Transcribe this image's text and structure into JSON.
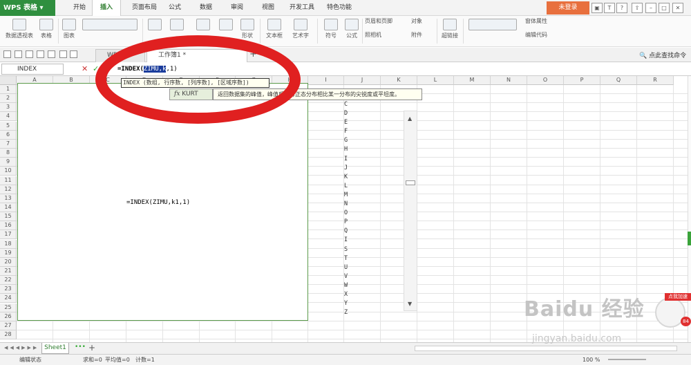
{
  "app": {
    "name": "WPS 表格",
    "login": "未登录"
  },
  "menu": [
    "开始",
    "插入",
    "页面布局",
    "公式",
    "数据",
    "审阅",
    "视图",
    "开发工具",
    "特色功能"
  ],
  "menu_active": 1,
  "ribbon": [
    {
      "label": "数据透视表"
    },
    {
      "label": "表格"
    },
    {
      "label": "图表"
    },
    {
      "label": ""
    },
    {
      "label": ""
    },
    {
      "label": ""
    },
    {
      "label": ""
    },
    {
      "label": ""
    },
    {
      "label": "形状"
    },
    {
      "label": "文本框"
    },
    {
      "label": "艺术字"
    },
    {
      "label": "符号"
    },
    {
      "label": "公式"
    },
    {
      "label": "页眉和页脚"
    },
    {
      "label": "对象"
    },
    {
      "label": "照相机"
    },
    {
      "label": "附件"
    },
    {
      "label": "超链接"
    },
    {
      "label": ""
    },
    {
      "label": "窗体属性"
    },
    {
      "label": "编辑代码"
    }
  ],
  "tabs": [
    {
      "label": "WPS"
    },
    {
      "label": "工作簿1 *"
    }
  ],
  "search": "点此查找命令",
  "namebox": "INDEX",
  "formula": {
    "pre": "=INDEX(",
    "mid": "ZIMU,k",
    "post": ",1)"
  },
  "columns": [
    "A",
    "B",
    "C",
    "D",
    "E",
    "F",
    "G",
    "H",
    "I",
    "J",
    "K",
    "L",
    "M",
    "N",
    "O",
    "P",
    "Q",
    "R"
  ],
  "rows": [
    "1",
    "2",
    "3",
    "4",
    "5",
    "6",
    "7",
    "8",
    "9",
    "10",
    "11",
    "12",
    "13",
    "14",
    "15",
    "16",
    "17",
    "18",
    "19",
    "20",
    "21",
    "22",
    "23",
    "24",
    "25",
    "26",
    "27",
    "28"
  ],
  "list": [
    "C",
    "D",
    "E",
    "F",
    "G",
    "H",
    "I",
    "J",
    "K",
    "L",
    "M",
    "N",
    "O",
    "P",
    "Q",
    "I",
    "S",
    "T",
    "U",
    "V",
    "W",
    "X",
    "Y",
    "Z"
  ],
  "cell_formula": "=INDEX(ZIMU,k1,1)",
  "tooltip": "INDEX (数组, 行序数, [列序数], [区域序数])",
  "suggestion": "KURT",
  "description": "返回数据集的峰值，峰值反映与正态分布相比某一分布的尖锐度或平坦度。",
  "sheet": "Sheet1",
  "status": {
    "mode": "编辑状态",
    "sum": "求和=0",
    "avg": "平均值=0",
    "count": "计数=1",
    "zoom": "100 %"
  },
  "watermark": {
    "main": "Baidu 经验",
    "sub": "jingyan.baidu.com"
  },
  "badge": "84",
  "fab_label": "点我加速"
}
